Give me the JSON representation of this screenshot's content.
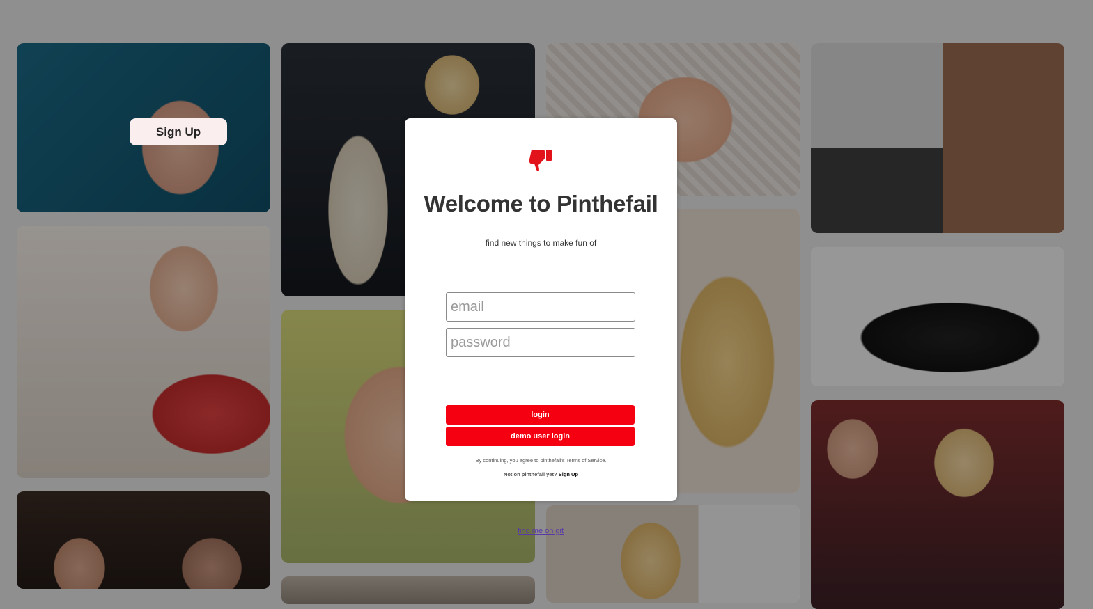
{
  "tile": {
    "signup_label": "Sign Up"
  },
  "modal": {
    "title": "Welcome to Pinthefail",
    "subtitle": "find new things to make fun of",
    "email_placeholder": "email",
    "password_placeholder": "password",
    "login_label": "login",
    "demo_label": "demo user login",
    "terms_text": "By continuing, you agree to pinthefail's Terms of Service.",
    "notyet_text": "Not on pinthefail yet?",
    "signup_link": "Sign Up"
  },
  "footer": {
    "find_link": "find me on git"
  },
  "colors": {
    "accent": "#f40011",
    "overlay": "rgba(0,0,0,0.38)",
    "modal_bg": "#ffffff"
  },
  "icons": {
    "logo": "thumbs-down-icon"
  }
}
